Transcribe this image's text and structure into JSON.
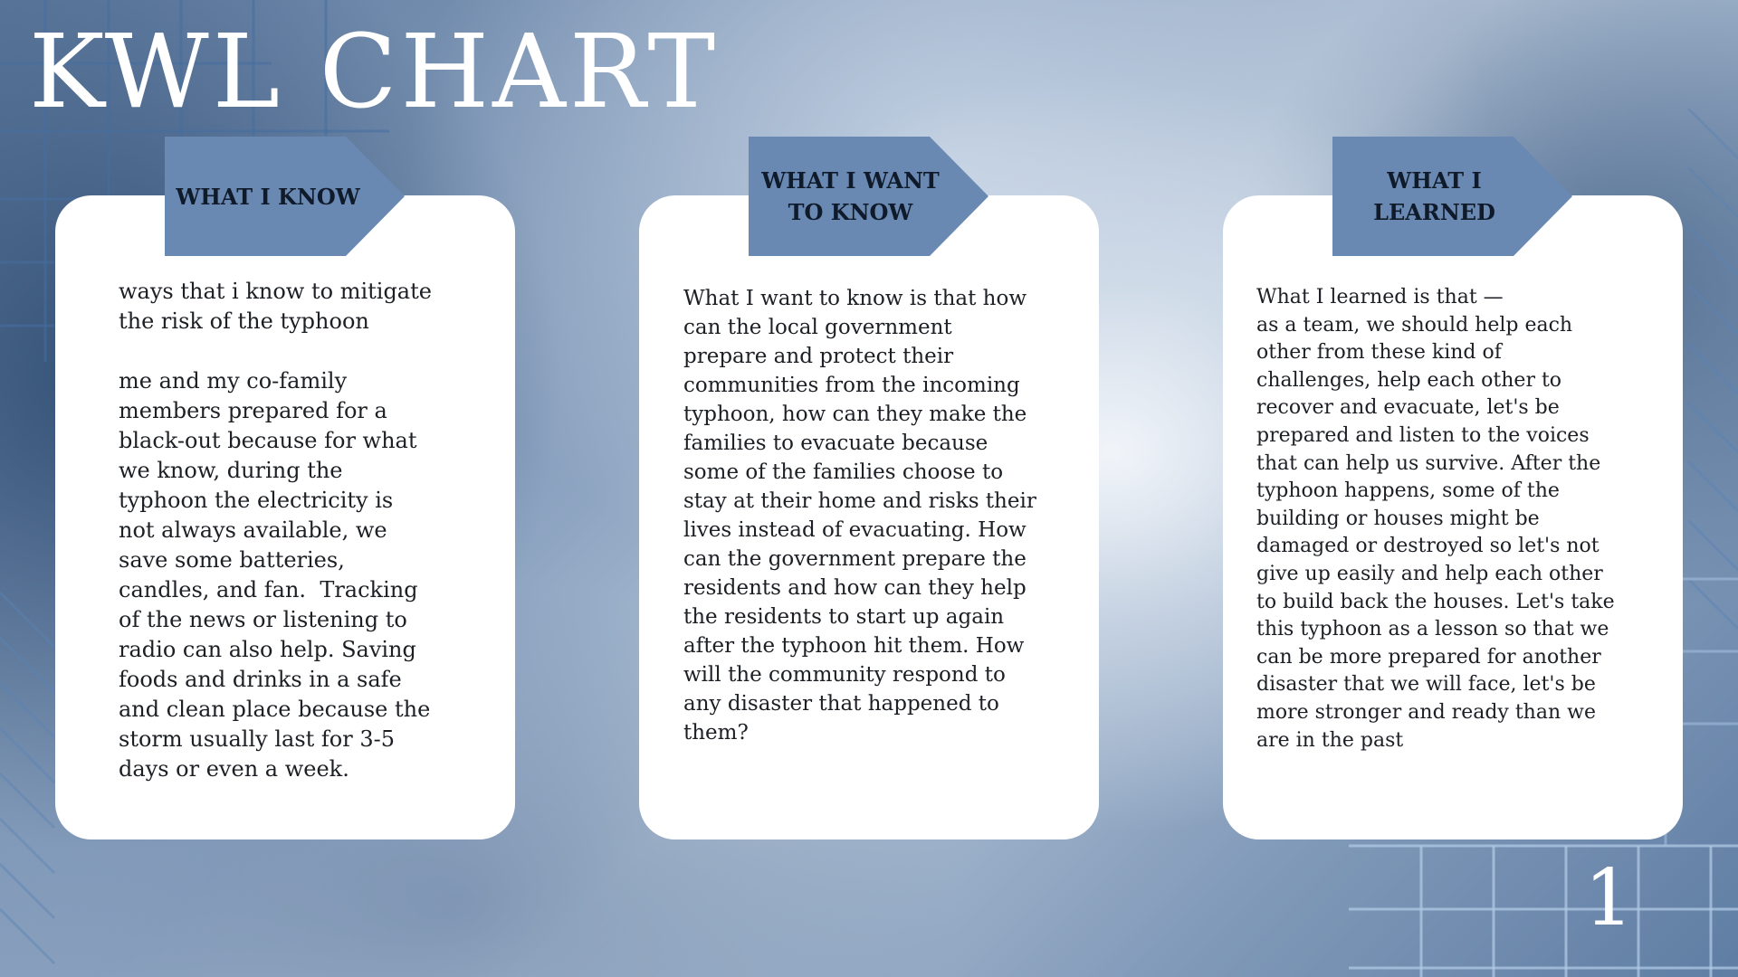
{
  "title": "KWL CHART",
  "columns": [
    {
      "heading": "WHAT I KNOW",
      "body": "ways that i know to mitigate\nthe risk of the typhoon\n\nme and my co-family\nmembers prepared for a\nblack-out because for what\nwe know, during the\ntyphoon the electricity is\nnot always available, we\nsave some batteries,\ncandles, and fan.  Tracking\nof the news or listening to\nradio can also help. Saving\nfoods and drinks in a safe\nand clean place because the\nstorm usually last for 3-5\ndays or even a week."
    },
    {
      "heading": "WHAT I WANT\nTO KNOW",
      "body": "What I want to know is that how\ncan the local government\nprepare and protect their\ncommunities from the incoming\ntyphoon, how can they make the\nfamilies to evacuate because\nsome of the families choose to\nstay at their home and risks their\nlives instead of evacuating. How\ncan the government prepare the\nresidents and how can they help\nthe residents to start up again\nafter the typhoon hit them. How\nwill the community respond to\nany disaster that happened to\nthem?"
    },
    {
      "heading": "WHAT I\nLEARNED",
      "body": "What I learned is that —\nas a team, we should help each\nother from these kind of\nchallenges, help each other to\nrecover and evacuate, let's be\nprepared and listen to the voices\nthat can help us survive. After the\ntyphoon happens, some of the\nbuilding or houses might be\ndamaged or destroyed so let's not\ngive up easily and help each other\nto build back the houses. Let's take\nthis typhoon as a lesson so that we\ncan be more prepared for another\ndisaster that we will face, let's be\nmore stronger and ready than we\nare in the past"
    }
  ],
  "page_number": "1",
  "colors": {
    "tag": "#6a89b2",
    "card": "#ffffff",
    "text": "#1c1f24",
    "title": "#ffffff"
  }
}
